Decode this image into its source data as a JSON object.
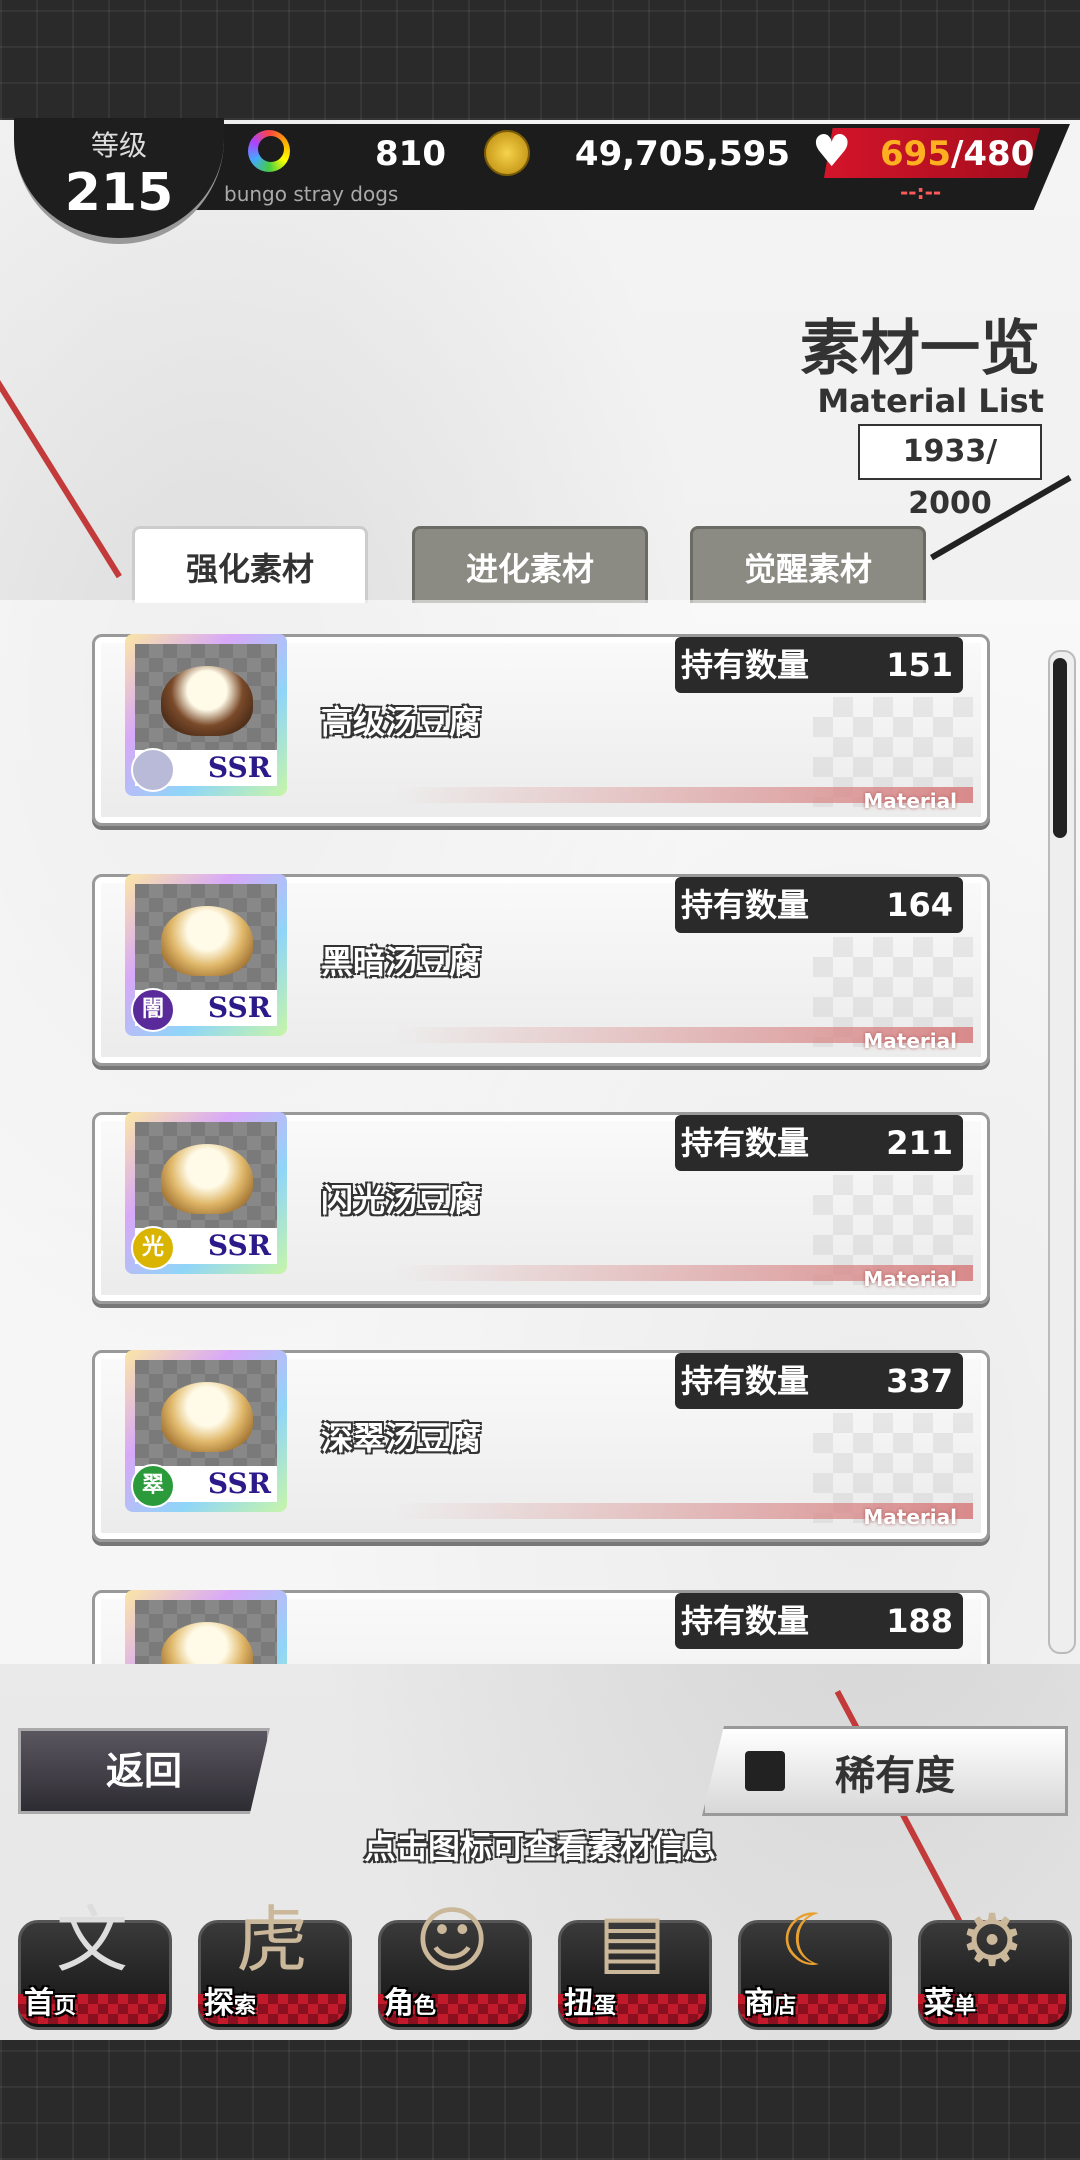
{
  "header": {
    "level_label": "等级",
    "level_value": "215",
    "gems": "810",
    "coins": "49,705,595",
    "ap_current": "695",
    "ap_max": "/480",
    "ap_timer": "--:--",
    "subtitle": "bungo stray dogs"
  },
  "title": {
    "main": "素材一览",
    "sub": "Material List",
    "capacity": "1933/ 2000"
  },
  "tabs": [
    {
      "label": "强化素材",
      "active": true
    },
    {
      "label": "进化素材",
      "active": false
    },
    {
      "label": "觉醒素材",
      "active": false
    }
  ],
  "qty_label": "持有数量",
  "material_word": "Material",
  "rarity_word": "SSR",
  "items": [
    {
      "name": "高级汤豆腐",
      "qty": "151",
      "attr": "",
      "attr_color": "#b9b9d8"
    },
    {
      "name": "黑暗汤豆腐",
      "qty": "164",
      "attr": "闇",
      "attr_color": "#5b2a9a"
    },
    {
      "name": "闪光汤豆腐",
      "qty": "211",
      "attr": "光",
      "attr_color": "#d9b400"
    },
    {
      "name": "深翠汤豆腐",
      "qty": "337",
      "attr": "翠",
      "attr_color": "#2a9a3a"
    },
    {
      "name": "",
      "qty": "188",
      "attr": "",
      "attr_color": "#b9b9d8"
    }
  ],
  "controls": {
    "back": "返回",
    "rarity": "稀有度",
    "hint": "点击图标可查看素材信息"
  },
  "nav": [
    {
      "label_big": "首",
      "label_small": "页",
      "icon": "home-icon",
      "glyph": "文"
    },
    {
      "label_big": "探",
      "label_small": "索",
      "icon": "tiger-icon",
      "glyph": "虎"
    },
    {
      "label_big": "角",
      "label_small": "色",
      "icon": "characters-icon",
      "glyph": "👥"
    },
    {
      "label_big": "扭",
      "label_small": "蛋",
      "icon": "book-icon",
      "glyph": "📖"
    },
    {
      "label_big": "商",
      "label_small": "店",
      "icon": "crescent-icon",
      "glyph": "☾"
    },
    {
      "label_big": "菜",
      "label_small": "单",
      "icon": "gear-icon",
      "glyph": "⚙"
    }
  ]
}
